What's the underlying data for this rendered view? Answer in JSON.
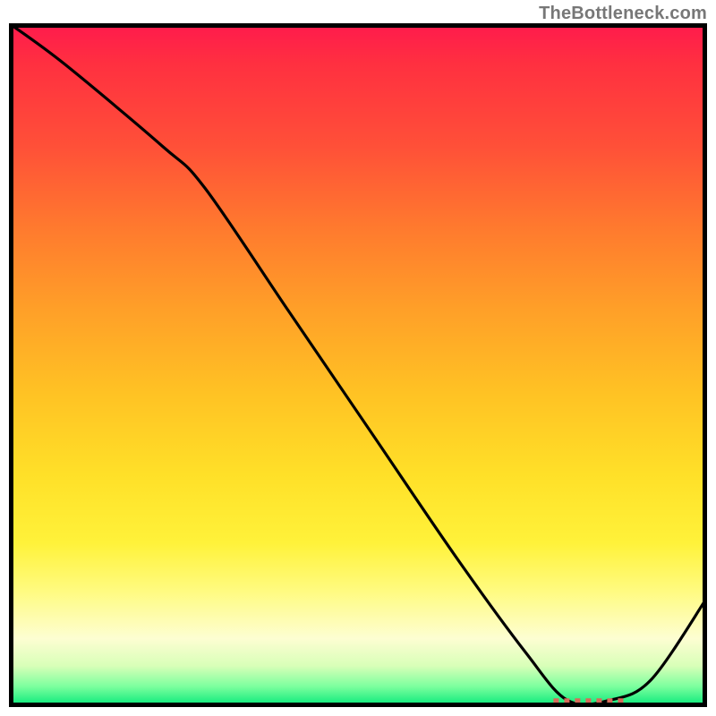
{
  "watermark": "TheBottleneck.com",
  "chart_data": {
    "type": "line",
    "title": "",
    "xlabel": "",
    "ylabel": "",
    "xlim": [
      0,
      100
    ],
    "ylim": [
      0,
      100
    ],
    "series": [
      {
        "name": "curve",
        "x": [
          0,
          8,
          22,
          28,
          40,
          52,
          64,
          74,
          80,
          86,
          92,
          100
        ],
        "y": [
          100,
          94,
          82,
          76,
          58,
          40,
          22,
          8,
          1,
          1,
          4,
          16
        ]
      }
    ],
    "annotations": [
      {
        "name": "optimal-range-dash",
        "type": "dashed-segment",
        "x0": 78,
        "x1": 88,
        "y": 0.5
      }
    ],
    "background": "heatmap-gradient-red-orange-yellow-green"
  }
}
